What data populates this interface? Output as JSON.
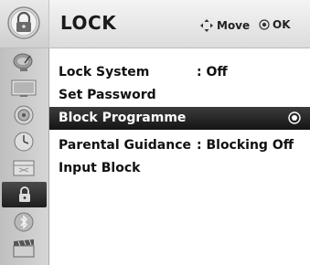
{
  "header": {
    "title": "LOCK",
    "hints": {
      "move_label": "Move",
      "ok_label": "OK"
    },
    "icon": "padlock-icon"
  },
  "sidebar": {
    "items": [
      {
        "icon": "satellite-dish-icon"
      },
      {
        "icon": "tv-screen-icon"
      },
      {
        "icon": "speaker-icon"
      },
      {
        "icon": "clock-icon"
      },
      {
        "icon": "window-icon"
      },
      {
        "icon": "padlock-icon",
        "active": true
      },
      {
        "icon": "bluetooth-icon"
      },
      {
        "icon": "clapperboard-icon"
      }
    ]
  },
  "menu": {
    "items": [
      {
        "label": "Lock System",
        "value": ": Off"
      },
      {
        "label": "Set Password",
        "value": ""
      },
      {
        "label": "Block Programme",
        "value": "",
        "selected": true
      },
      {
        "label": "Parental Guidance",
        "value": ": Blocking Off"
      },
      {
        "label": "Input Block",
        "value": ""
      }
    ]
  },
  "colors": {
    "selected_bg": "#1e1e1e",
    "sidebar_bg": "#c8c8c8",
    "header_bg": "#e6e6e6"
  }
}
